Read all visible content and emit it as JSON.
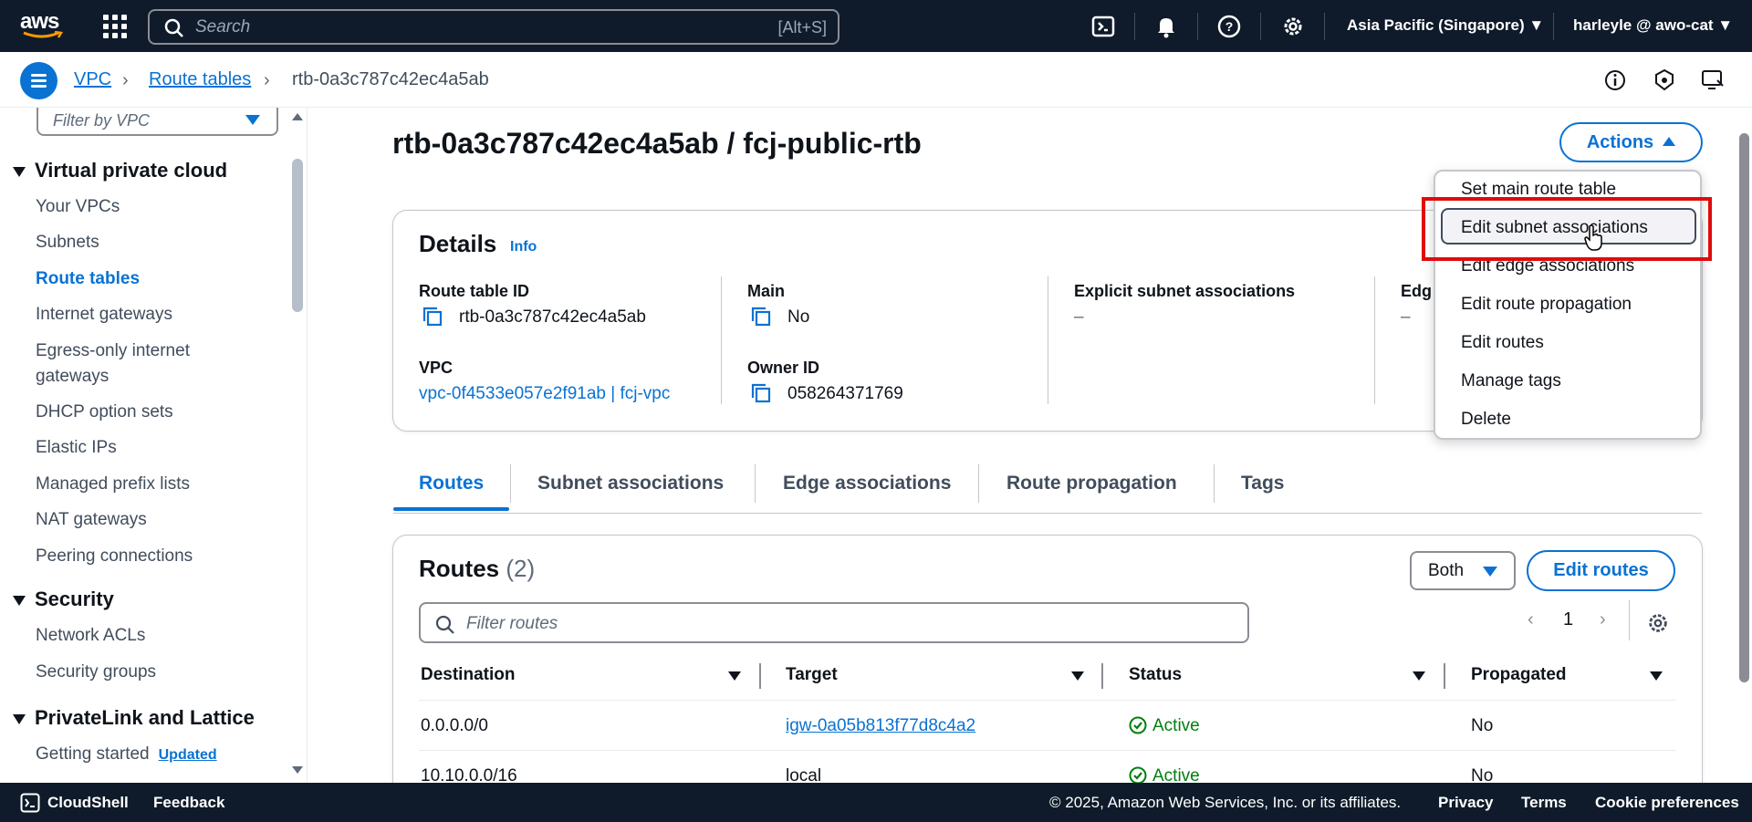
{
  "topnav": {
    "logo_text": "aws",
    "search_placeholder": "Search",
    "search_shortcut": "[Alt+S]",
    "region": "Asia Pacific (Singapore) ▼",
    "user": "harleyle @ awo-cat ▼"
  },
  "breadcrumb": {
    "items": [
      "VPC",
      "Route tables",
      "rtb-0a3c787c42ec4a5ab"
    ]
  },
  "sidebar": {
    "filter_placeholder": "Filter by VPC",
    "sections": [
      {
        "title": "Virtual private cloud"
      },
      {
        "title": "Security"
      },
      {
        "title": "PrivateLink and Lattice"
      }
    ],
    "vpc_items": [
      "Your VPCs",
      "Subnets",
      "Route tables",
      "Internet gateways",
      "Egress-only internet",
      "gateways",
      "DHCP option sets",
      "Elastic IPs",
      "Managed prefix lists",
      "NAT gateways",
      "Peering connections"
    ],
    "security_items": [
      "Network ACLs",
      "Security groups"
    ],
    "privatelink_items": [
      "Getting started"
    ],
    "updated_badge": "Updated"
  },
  "main": {
    "title": "rtb-0a3c787c42ec4a5ab / fcj-public-rtb",
    "actions_label": "Actions",
    "details": {
      "title": "Details",
      "info": "Info",
      "route_table_id_label": "Route table ID",
      "route_table_id": "rtb-0a3c787c42ec4a5ab",
      "vpc_label": "VPC",
      "vpc_value": "vpc-0f4533e057e2f91ab | fcj-vpc",
      "main_label": "Main",
      "main_value": "No",
      "owner_label": "Owner ID",
      "owner_value": "058264371769",
      "explicit_label": "Explicit subnet associations",
      "explicit_value": "–",
      "edge_label": "Edg",
      "edge_value": "–"
    },
    "tabs": [
      "Routes",
      "Subnet associations",
      "Edge associations",
      "Route propagation",
      "Tags"
    ],
    "routes": {
      "title": "Routes",
      "count": "(2)",
      "both_label": "Both",
      "edit_routes_label": "Edit routes",
      "filter_placeholder": "Filter routes",
      "page": "1",
      "columns": [
        "Destination",
        "Target",
        "Status",
        "Propagated"
      ],
      "rows": [
        {
          "destination": "0.0.0.0/0",
          "target": "igw-0a05b813f77d8c4a2",
          "status": "Active",
          "propagated": "No"
        },
        {
          "destination": "10.10.0.0/16",
          "target": "local",
          "status": "Active",
          "propagated": "No"
        }
      ]
    }
  },
  "actions_menu": {
    "items": [
      "Set main route table",
      "Edit subnet associations",
      "Edit edge associations",
      "Edit route propagation",
      "Edit routes",
      "Manage tags",
      "Delete"
    ]
  },
  "footer": {
    "cloudshell": "CloudShell",
    "feedback": "Feedback",
    "copyright": "© 2025, Amazon Web Services, Inc. or its affiliates.",
    "privacy": "Privacy",
    "terms": "Terms",
    "cookies": "Cookie preferences"
  },
  "colors": {
    "nav_bg": "#0f1b2a",
    "accent": "#0972d3",
    "success": "#037f0c",
    "highlight": "#e00b0b"
  }
}
